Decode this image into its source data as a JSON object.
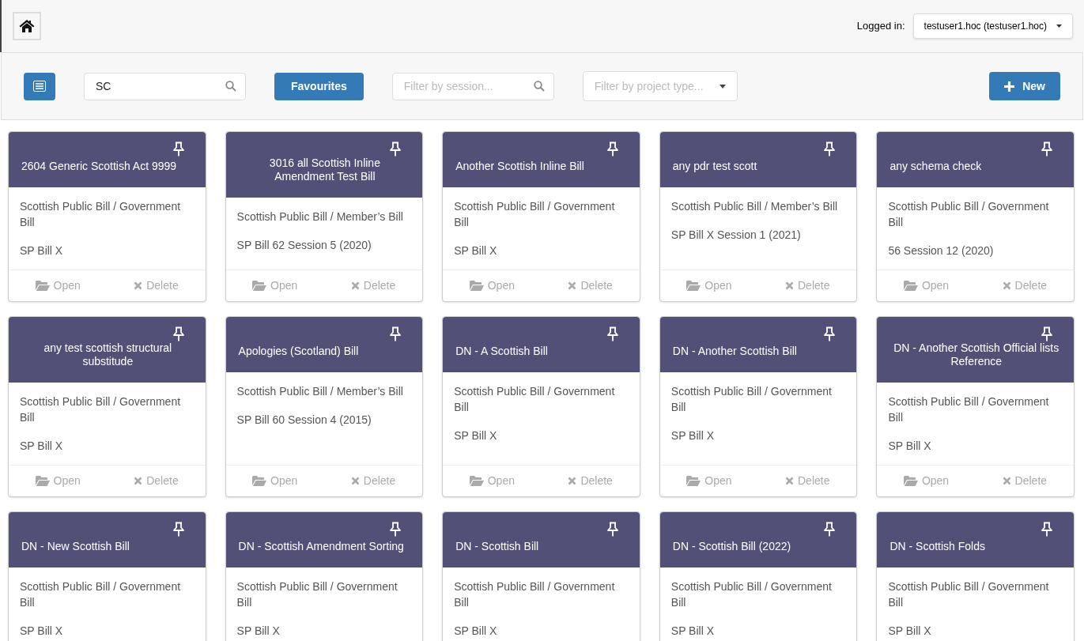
{
  "header": {
    "logged_in_label": "Logged in:",
    "user": "testuser1.hoc (testuser1.hoc)"
  },
  "toolbar": {
    "search": {
      "value": "SC"
    },
    "favourites": "Favourites",
    "session_filter": {
      "placeholder": "Filter by session..."
    },
    "project_type_filter": {
      "placeholder": "Filter by project type..."
    },
    "new_button": "New"
  },
  "projects": [
    {
      "title": "2604 Generic Scottish Act 9999",
      "type": "Scottish Public Bill / Government Bill",
      "reference": "SP Bill X",
      "open": "Open",
      "delete": "Delete"
    },
    {
      "title": "3016 all Scottish Inline Amendment Test Bill",
      "type": "Scottish Public Bill / Member’s Bill",
      "reference": "SP Bill 62 Session 5 (2020)",
      "open": "Open",
      "delete": "Delete"
    },
    {
      "title": "Another Scottish Inline Bill",
      "type": "Scottish Public Bill / Government Bill",
      "reference": "SP Bill X",
      "open": "Open",
      "delete": "Delete"
    },
    {
      "title": "any pdr test scott",
      "type": "Scottish Public Bill / Member’s Bill",
      "reference": "SP Bill X Session 1 (2021)",
      "open": "Open",
      "delete": "Delete"
    },
    {
      "title": "any schema check",
      "type": "Scottish Public Bill / Government Bill",
      "reference": "56 Session 12 (2020)",
      "open": "Open",
      "delete": "Delete"
    },
    {
      "title": "any test scottish structural substitude",
      "type": "Scottish Public Bill / Government Bill",
      "reference": "SP Bill X",
      "open": "Open",
      "delete": "Delete"
    },
    {
      "title": "Apologies (Scotland) Bill",
      "type": "Scottish Public Bill / Member’s Bill",
      "reference": "SP Bill 60 Session 4 (2015)",
      "open": "Open",
      "delete": "Delete"
    },
    {
      "title": "DN - A Scottish Bill",
      "type": "Scottish Public Bill / Government Bill",
      "reference": "SP Bill X",
      "open": "Open",
      "delete": "Delete"
    },
    {
      "title": "DN - Another Scottish Bill",
      "type": "Scottish Public Bill / Government Bill",
      "reference": "SP Bill X",
      "open": "Open",
      "delete": "Delete"
    },
    {
      "title": "DN - Another Scottish Official lists Reference",
      "type": "Scottish Public Bill / Government Bill",
      "reference": "SP Bill X",
      "open": "Open",
      "delete": "Delete"
    },
    {
      "title": "DN - New Scottish Bill",
      "type": "Scottish Public Bill / Government Bill",
      "reference": "SP Bill X"
    },
    {
      "title": "DN - Scottish Amendment Sorting",
      "type": "Scottish Public Bill / Government Bill",
      "reference": "SP Bill X"
    },
    {
      "title": "DN - Scottish Bill",
      "type": "Scottish Public Bill / Government Bill",
      "reference": "SP Bill X"
    },
    {
      "title": "DN - Scottish Bill (2022)",
      "type": "Scottish Public Bill / Government Bill",
      "reference": "SP Bill X"
    },
    {
      "title": "DN - Scottish Folds",
      "type": "Scottish Public Bill / Government Bill",
      "reference": "SP Bill X"
    }
  ]
}
